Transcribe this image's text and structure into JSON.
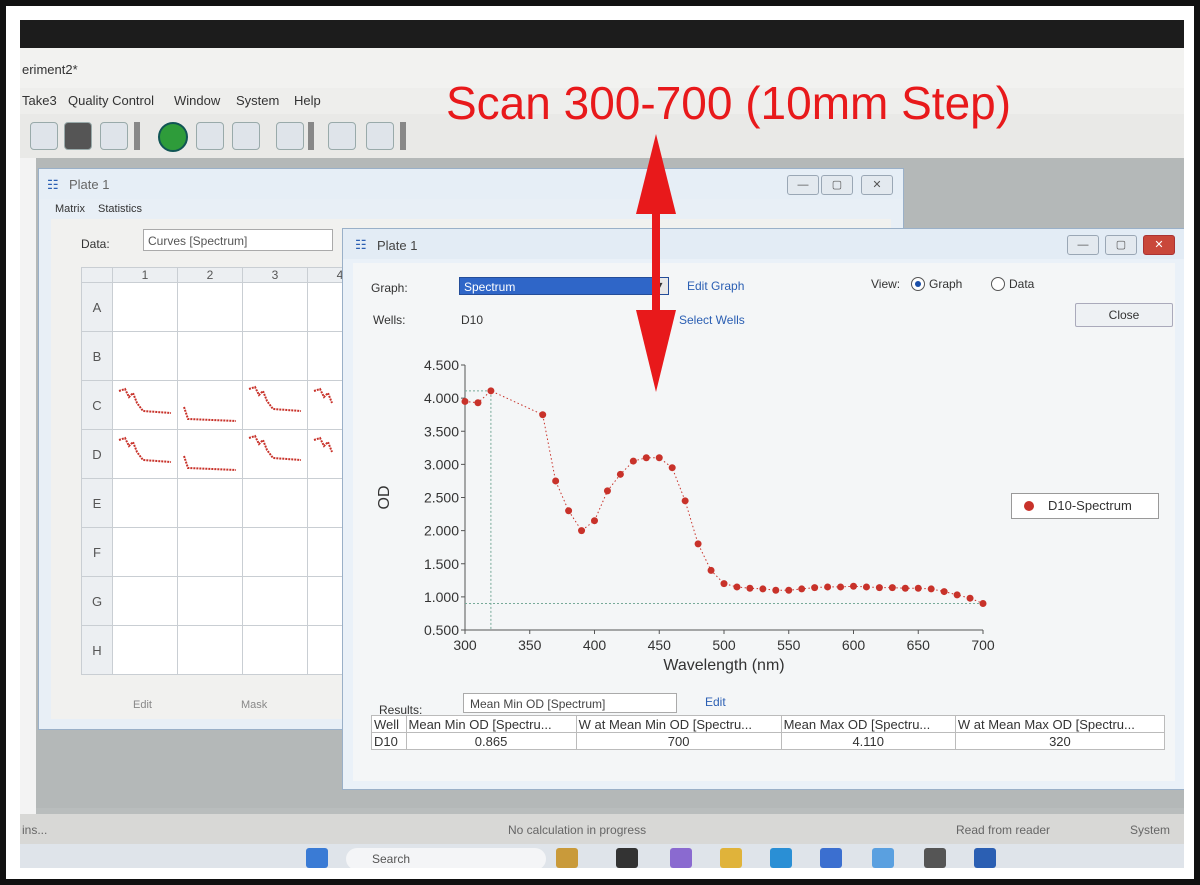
{
  "window_title": "eriment2*",
  "menu": [
    "Take3",
    "Quality Control",
    "Window",
    "System",
    "Help"
  ],
  "back_window": {
    "title": "Plate 1",
    "tabs": [
      "Matrix",
      "Statistics"
    ],
    "data_label": "Data:",
    "data_value": "Curves [Spectrum]",
    "columns": [
      "1",
      "2",
      "3",
      "4"
    ],
    "rows": [
      "A",
      "B",
      "C",
      "D",
      "E",
      "F",
      "G",
      "H"
    ],
    "edit_label": "Edit",
    "mask_label": "Mask"
  },
  "front_window": {
    "title": "Plate 1",
    "graph_label": "Graph:",
    "graph_value": "Spectrum",
    "edit_graph": "Edit Graph",
    "wells_label": "Wells:",
    "wells_value": "D10",
    "select_wells": "Select Wells",
    "view_label": "View:",
    "view_graph": "Graph",
    "view_data": "Data",
    "close_label": "Close",
    "results_label": "Results:",
    "results_value": "Mean Min OD [Spectrum]",
    "results_edit": "Edit",
    "table": {
      "headers": [
        "Well",
        "Mean Min OD [Spectru...",
        "W at Mean Min OD [Spectru...",
        "Mean Max OD [Spectru...",
        "W at Mean Max OD [Spectru..."
      ],
      "rows": [
        [
          "D10",
          "0.865",
          "700",
          "4.110",
          "320"
        ]
      ]
    }
  },
  "chart_data": {
    "type": "scatter",
    "xlabel": "Wavelength (nm)",
    "ylabel": "OD",
    "xlim": [
      300,
      700
    ],
    "ylim": [
      0.5,
      4.5
    ],
    "xticks": [
      "300",
      "350",
      "400",
      "450",
      "500",
      "550",
      "600",
      "650",
      "700"
    ],
    "yticks": [
      "0.500",
      "1.000",
      "1.500",
      "2.000",
      "2.500",
      "3.000",
      "3.500",
      "4.000",
      "4.500"
    ],
    "series": [
      {
        "name": "D10-Spectrum",
        "color": "#c8322a",
        "x": [
          300,
          310,
          320,
          360,
          370,
          380,
          390,
          400,
          410,
          420,
          430,
          440,
          450,
          460,
          470,
          480,
          490,
          500,
          510,
          520,
          530,
          540,
          550,
          560,
          570,
          580,
          590,
          600,
          610,
          620,
          630,
          640,
          650,
          660,
          670,
          680,
          690,
          700
        ],
        "y": [
          3.95,
          3.93,
          4.11,
          3.75,
          2.75,
          2.3,
          2.0,
          2.15,
          2.6,
          2.85,
          3.05,
          3.1,
          3.1,
          2.95,
          2.45,
          1.8,
          1.4,
          1.2,
          1.15,
          1.13,
          1.12,
          1.1,
          1.1,
          1.12,
          1.14,
          1.15,
          1.15,
          1.16,
          1.15,
          1.14,
          1.14,
          1.13,
          1.13,
          1.12,
          1.08,
          1.03,
          0.98,
          0.9
        ]
      }
    ]
  },
  "annotation": "Scan 300-700 (10mm Step)",
  "status": {
    "calc": "No calculation in progress",
    "read": "Read from reader",
    "system": "System",
    "left": "ins..."
  },
  "taskbar": {
    "search": "Search"
  }
}
